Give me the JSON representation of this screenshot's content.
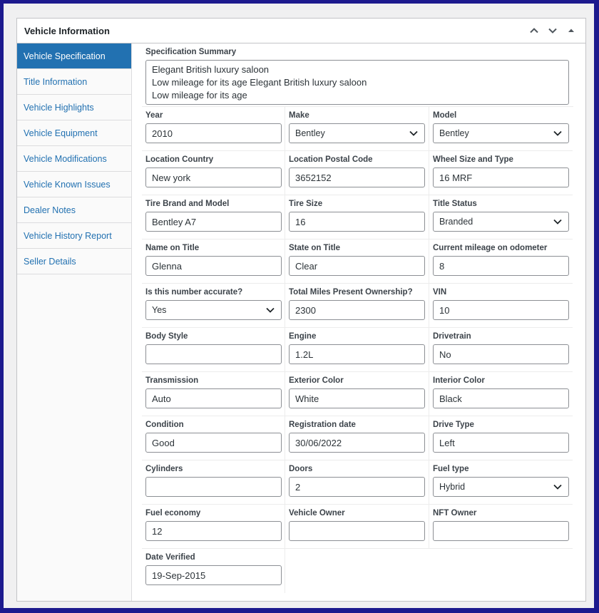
{
  "panel": {
    "title": "Vehicle Information"
  },
  "tabs": [
    {
      "label": "Vehicle Specification",
      "active": true
    },
    {
      "label": "Title Information"
    },
    {
      "label": "Vehicle Highlights"
    },
    {
      "label": "Vehicle Equipment"
    },
    {
      "label": "Vehicle Modifications"
    },
    {
      "label": "Vehicle Known Issues"
    },
    {
      "label": "Dealer Notes"
    },
    {
      "label": "Vehicle History Report"
    },
    {
      "label": "Seller Details"
    }
  ],
  "summary": {
    "label": "Specification Summary",
    "value": "Elegant British luxury saloon\nLow mileage for its age Elegant British luxury saloon\nLow mileage for its age"
  },
  "fields": [
    {
      "label": "Year",
      "value": "2010",
      "type": "text"
    },
    {
      "label": "Make",
      "value": "Bentley",
      "type": "select"
    },
    {
      "label": "Model",
      "value": "Bentley",
      "type": "select"
    },
    {
      "label": "Location Country",
      "value": "New york",
      "type": "text"
    },
    {
      "label": "Location Postal Code",
      "value": "3652152",
      "type": "text"
    },
    {
      "label": "Wheel Size and Type",
      "value": "16 MRF",
      "type": "text"
    },
    {
      "label": "Tire Brand and Model",
      "value": "Bentley A7",
      "type": "text"
    },
    {
      "label": "Tire Size",
      "value": "16",
      "type": "text"
    },
    {
      "label": "Title Status",
      "value": "Branded",
      "type": "select"
    },
    {
      "label": "Name on Title",
      "value": "Glenna",
      "type": "text"
    },
    {
      "label": "State on Title",
      "value": "Clear",
      "type": "text"
    },
    {
      "label": "Current mileage on odometer",
      "value": "8",
      "type": "text"
    },
    {
      "label": "Is this number accurate?",
      "value": "Yes",
      "type": "select"
    },
    {
      "label": "Total Miles Present Ownership?",
      "value": "2300",
      "type": "text"
    },
    {
      "label": "VIN",
      "value": "10",
      "type": "text"
    },
    {
      "label": "Body Style",
      "value": "",
      "type": "text"
    },
    {
      "label": "Engine",
      "value": "1.2L",
      "type": "text"
    },
    {
      "label": "Drivetrain",
      "value": "No",
      "type": "text"
    },
    {
      "label": "Transmission",
      "value": "Auto",
      "type": "text"
    },
    {
      "label": "Exterior Color",
      "value": "White",
      "type": "text"
    },
    {
      "label": "Interior Color",
      "value": "Black",
      "type": "text"
    },
    {
      "label": "Condition",
      "value": "Good",
      "type": "text"
    },
    {
      "label": "Registration date",
      "value": "30/06/2022",
      "type": "text"
    },
    {
      "label": "Drive Type",
      "value": "Left",
      "type": "text"
    },
    {
      "label": "Cylinders",
      "value": "",
      "type": "text"
    },
    {
      "label": "Doors",
      "value": "2",
      "type": "text"
    },
    {
      "label": "Fuel type",
      "value": "Hybrid",
      "type": "select"
    },
    {
      "label": "Fuel economy",
      "value": "12",
      "type": "text"
    },
    {
      "label": "Vehicle Owner",
      "value": "",
      "type": "text"
    },
    {
      "label": "NFT Owner",
      "value": "",
      "type": "text"
    },
    {
      "label": "Date Verified",
      "value": "19-Sep-2015",
      "type": "text"
    }
  ],
  "icons": {
    "up": "chevron-up-icon",
    "down": "chevron-down-icon",
    "toggle": "triangle-up-icon",
    "select": "chevron-down-icon"
  }
}
